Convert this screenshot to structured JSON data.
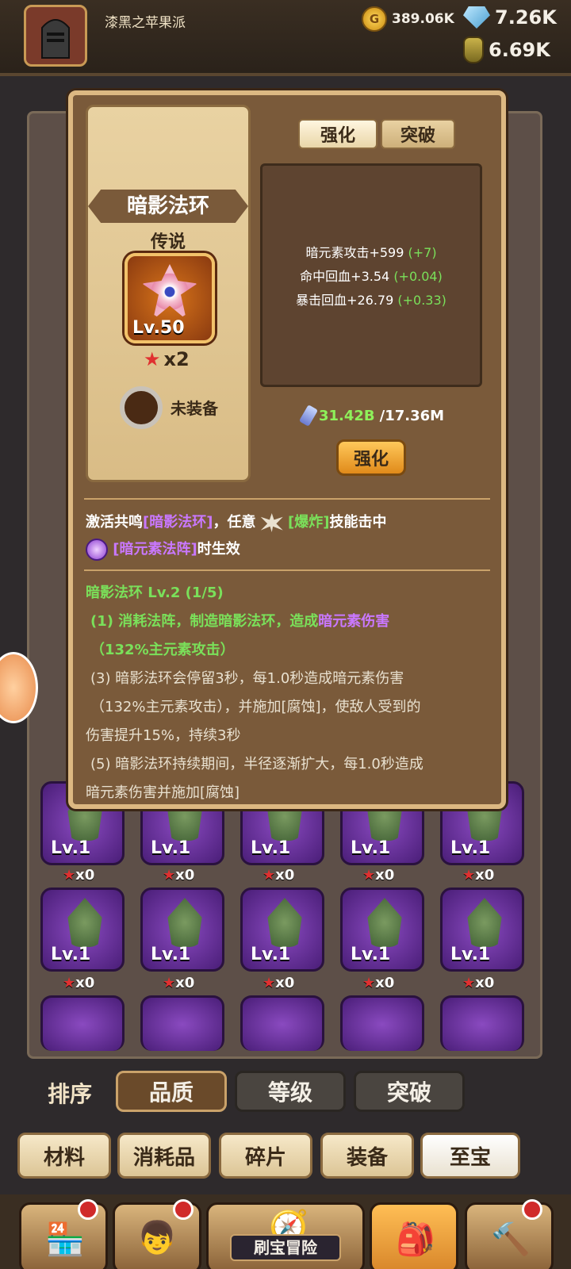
{
  "player": {
    "name": "漆黑之苹果派"
  },
  "currencies": {
    "gold": "389.06K",
    "gems": "7.26K",
    "potions": "6.69K"
  },
  "modal": {
    "item_name": "暗影法环",
    "rarity": "传说",
    "level": "Lv.50",
    "stars": "x2",
    "equip_status": "未装备",
    "tabs": [
      "强化",
      "突破"
    ],
    "stats": [
      {
        "text": "暗元素攻击+599",
        "bonus": "(+7)"
      },
      {
        "text": "命中回血+3.54",
        "bonus": "(+0.04)"
      },
      {
        "text": "暴击回血+26.79",
        "bonus": "(+0.33)"
      }
    ],
    "cost_have": "31.42B",
    "cost_need": "/17.36M",
    "enhance_button": "强化",
    "resonance": {
      "part1": "激活共鸣",
      "item": "[暗影法环]",
      "part2": "，任意",
      "skill": "[爆炸]",
      "part3": "技能击中",
      "array": "[暗元素法阵]",
      "part4": "时生效"
    },
    "skill": {
      "title": "暗影法环 Lv.2 (1/5)",
      "l1a": "(1) 消耗法阵，制造暗影法环，造成",
      "l1b": "暗元素伤害",
      "l1c": "（132%主元素攻击）",
      "l3a": "(3) 暗影法环会停留3秒，每1.0秒造成暗元素伤害",
      "l3b": "（132%主元素攻击），并施加[腐蚀]，使敌人受到的",
      "l3c": "伤害提升15%，持续3秒",
      "l5a": "(5) 暗影法环持续期间，半径逐渐扩大，每1.0秒造成",
      "l5b": "暗元素伤害并施加[腐蚀]"
    }
  },
  "inventory": {
    "slot_level": "Lv.1",
    "slot_count": "x0"
  },
  "sort": {
    "label": "排序",
    "options": [
      "品质",
      "等级",
      "突破"
    ],
    "active": "品质"
  },
  "categories": [
    "材料",
    "消耗品",
    "碎片",
    "装备",
    "至宝"
  ],
  "active_category": "至宝",
  "nav": {
    "adventure_label": "刷宝冒险"
  },
  "colors": {
    "accent_green": "#7ae05a",
    "accent_purple": "#c978ff",
    "button_orange": "#e08a1a"
  }
}
